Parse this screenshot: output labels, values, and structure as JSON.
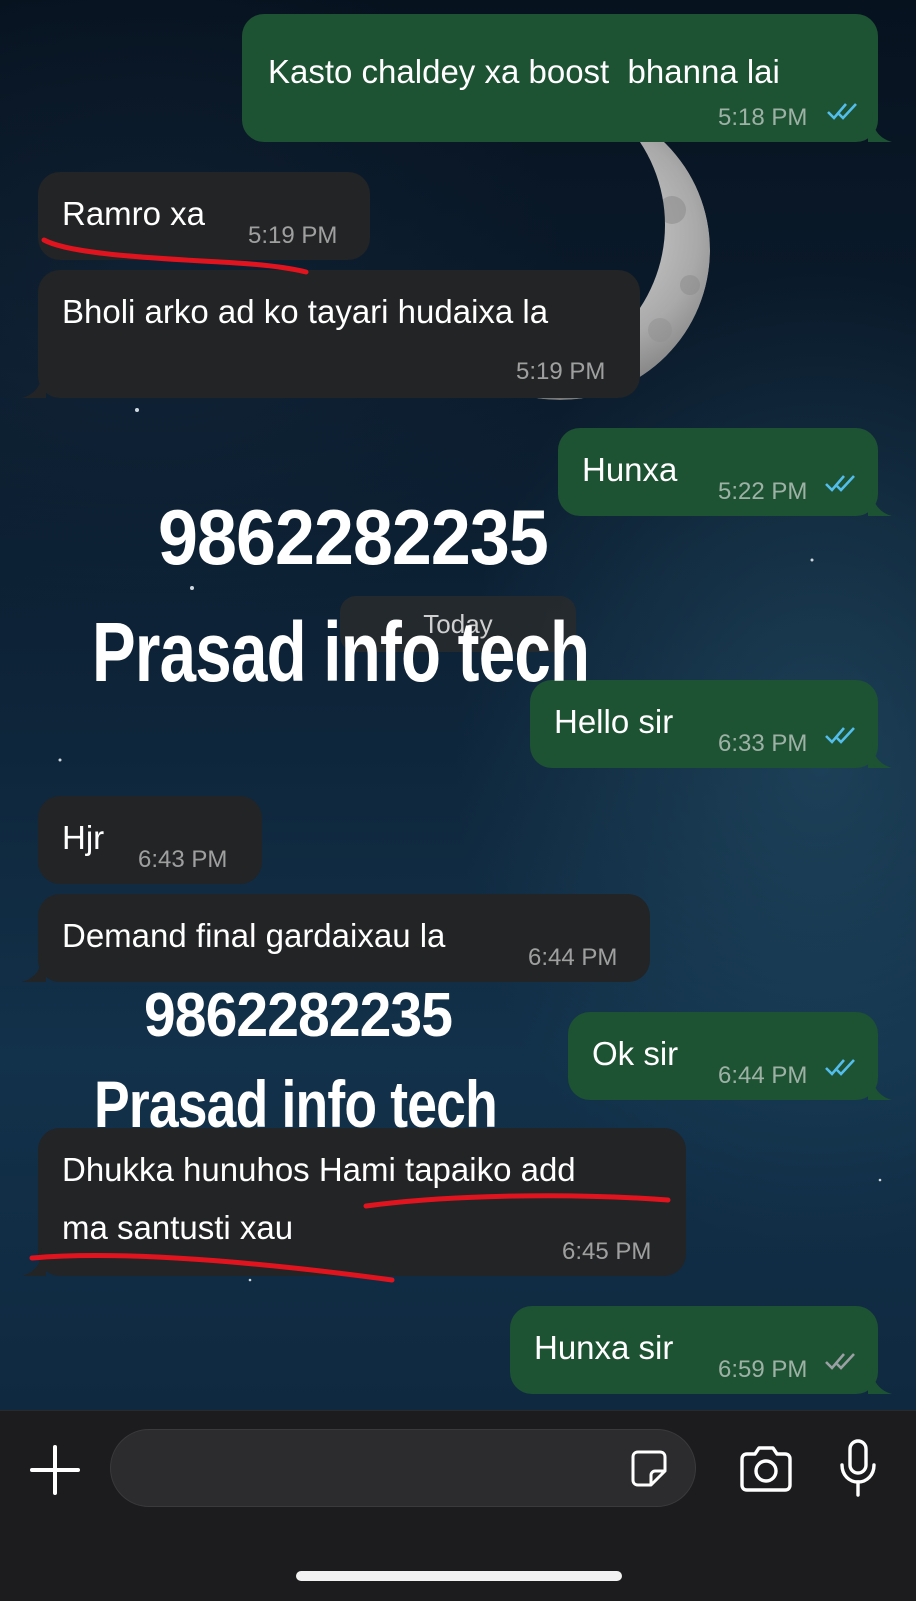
{
  "day_separator": "Today",
  "messages": [
    {
      "text": "Kasto chaldey xa boost  bhanna lai",
      "time": "5:18 PM",
      "direction": "outgoing",
      "status": "read"
    },
    {
      "text": "Ramro xa",
      "time": "5:19 PM",
      "direction": "incoming"
    },
    {
      "text": "Bholi arko ad ko tayari hudaixa la",
      "time": "5:19 PM",
      "direction": "incoming"
    },
    {
      "text": "Hunxa",
      "time": "5:22 PM",
      "direction": "outgoing",
      "status": "read"
    },
    {
      "text": "Hello sir",
      "time": "6:33 PM",
      "direction": "outgoing",
      "status": "read"
    },
    {
      "text": "Hjr",
      "time": "6:43 PM",
      "direction": "incoming"
    },
    {
      "text": "Demand final gardaixau la",
      "time": "6:44 PM",
      "direction": "incoming"
    },
    {
      "text": "Ok sir",
      "time": "6:44 PM",
      "direction": "outgoing",
      "status": "read"
    },
    {
      "text_line1": "Dhukka hunuhos Hami tapaiko add",
      "text_line2": "ma santusti xau",
      "time": "6:45 PM",
      "direction": "incoming"
    },
    {
      "text": "Hunxa sir",
      "time": "6:59 PM",
      "direction": "outgoing",
      "status": "delivered"
    }
  ],
  "watermarks": [
    {
      "phone": "9862282235",
      "name": "Prasad info tech"
    },
    {
      "phone": "9862282235",
      "name": "Prasad info tech"
    }
  ],
  "composer": {
    "value": "",
    "placeholder": ""
  },
  "icons": {
    "read_color": "#53bdeb",
    "delivered_color": "#9aa0a3",
    "plus": "plus-icon",
    "sticker": "sticker-icon",
    "camera": "camera-icon",
    "mic": "microphone-icon"
  },
  "colors": {
    "outgoing_bubble": "#1d5233",
    "incoming_bubble": "#222425",
    "annotation_red": "#e0141e"
  }
}
